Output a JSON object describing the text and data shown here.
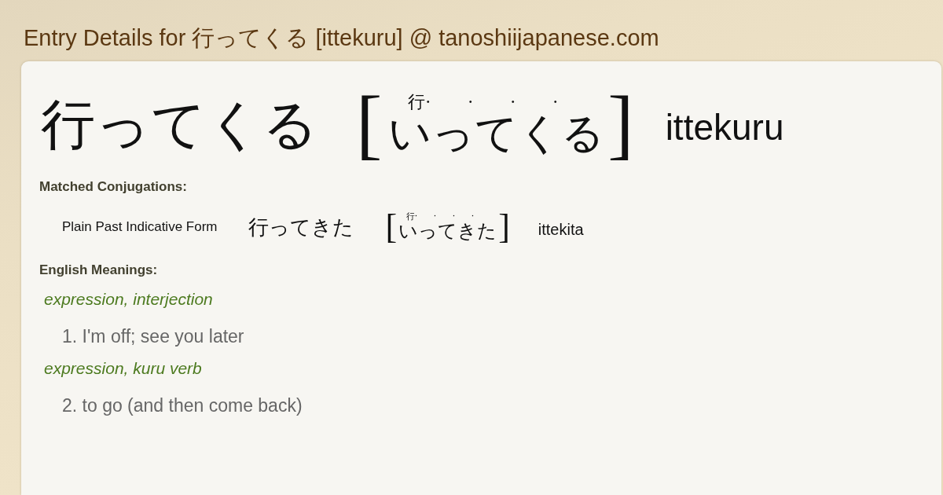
{
  "page": {
    "title": "Entry Details for 行ってくる [ittekuru] @ tanoshiijapanese.com"
  },
  "entry": {
    "word": "行ってくる",
    "bracket_open": "[",
    "reading": {
      "kana": "いってくる",
      "furigana": [
        "行·",
        "·",
        "·",
        "·"
      ]
    },
    "bracket_close": "]",
    "romaji": "ittekuru"
  },
  "conjugations": {
    "heading": "Matched Conjugations:",
    "items": [
      {
        "form": "Plain Past Indicative Form",
        "word": "行ってきた",
        "bracket_open": "[",
        "reading": {
          "kana": "いってきた",
          "furigana": [
            "行·",
            "·",
            "·",
            "·"
          ]
        },
        "bracket_close": "]",
        "romaji": "ittekita"
      }
    ]
  },
  "meanings": {
    "heading": "English Meanings:",
    "senses": [
      {
        "tags": "expression, interjection",
        "definition": "1. I'm off; see you later"
      },
      {
        "tags": "expression, kuru verb",
        "definition": "2. to go (and then come back)"
      }
    ]
  }
}
